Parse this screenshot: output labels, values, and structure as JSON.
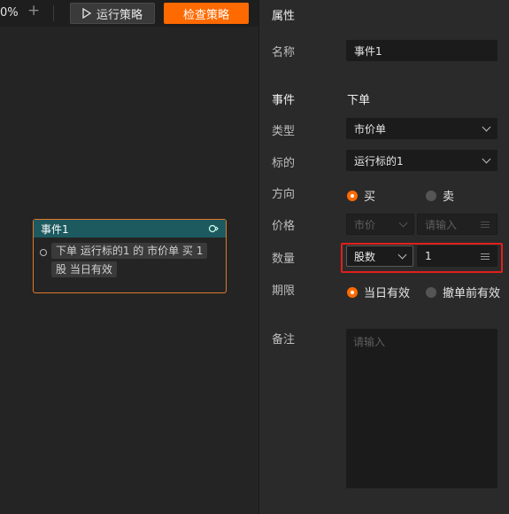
{
  "toolbar": {
    "zoom": "0%",
    "add_symbol": "+",
    "run_label": "运行策略",
    "check_label": "检查策略"
  },
  "colors": {
    "accent": "#ff6a00",
    "node_header": "#1d5a60",
    "highlight": "#e0201c"
  },
  "node": {
    "title": "事件1",
    "chips": [
      "下单 运行标的1 的 市价单 买 1",
      "股 当日有效"
    ]
  },
  "panel": {
    "title": "属性",
    "name_label": "名称",
    "name_value": "事件1",
    "event_label": "事件",
    "event_value": "下单",
    "type_label": "类型",
    "type_value": "市价单",
    "target_label": "标的",
    "target_value": "运行标的1",
    "direction_label": "方向",
    "direction_options": [
      {
        "label": "买",
        "selected": true
      },
      {
        "label": "卖",
        "selected": false
      }
    ],
    "price_label": "价格",
    "price_type": "市价",
    "price_placeholder": "请输入",
    "qty_label": "数量",
    "qty_unit": "股数",
    "qty_value": "1",
    "period_label": "期限",
    "period_options": [
      {
        "label": "当日有效",
        "selected": true
      },
      {
        "label": "撤单前有效",
        "selected": false
      }
    ],
    "remark_label": "备注",
    "remark_placeholder": "请输入"
  }
}
